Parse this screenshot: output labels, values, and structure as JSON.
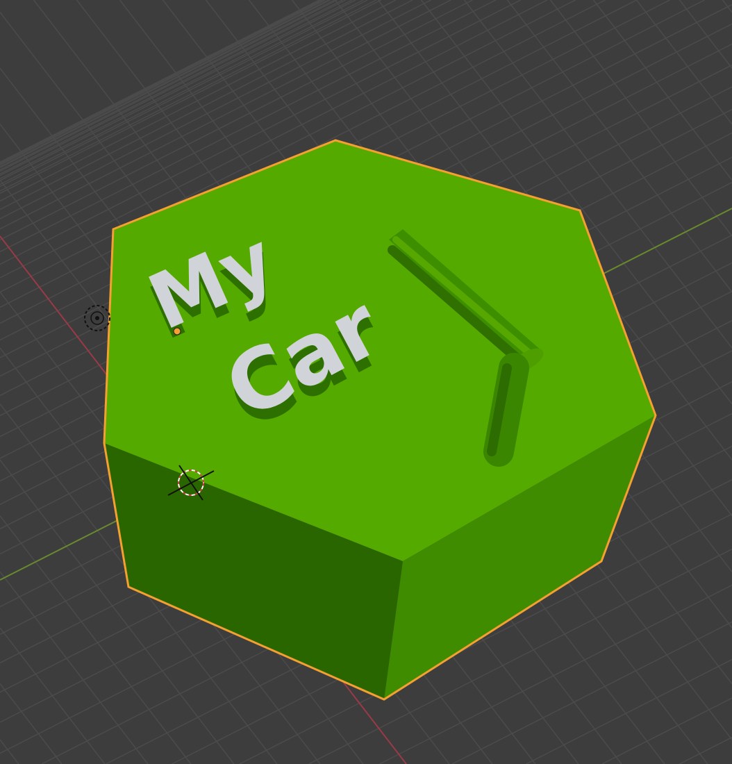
{
  "viewport": {
    "type": "3d-viewport",
    "background_color": "#3d3d3d",
    "grid_color": "#4b4b4b",
    "x_axis_color": "#9a3a48",
    "y_axis_color": "#6a8a2e"
  },
  "object": {
    "name_text_line1": "My",
    "name_text_line2": "Car",
    "top_color": "#55aa00",
    "left_side_color": "#2a6600",
    "right_side_color": "#3f8c00",
    "selection_outline_color": "#f5a030",
    "text_color": "#d0d4d8",
    "selected": true
  },
  "icons": [
    "light-icon",
    "origin-dot-icon",
    "3d-cursor-icon"
  ]
}
